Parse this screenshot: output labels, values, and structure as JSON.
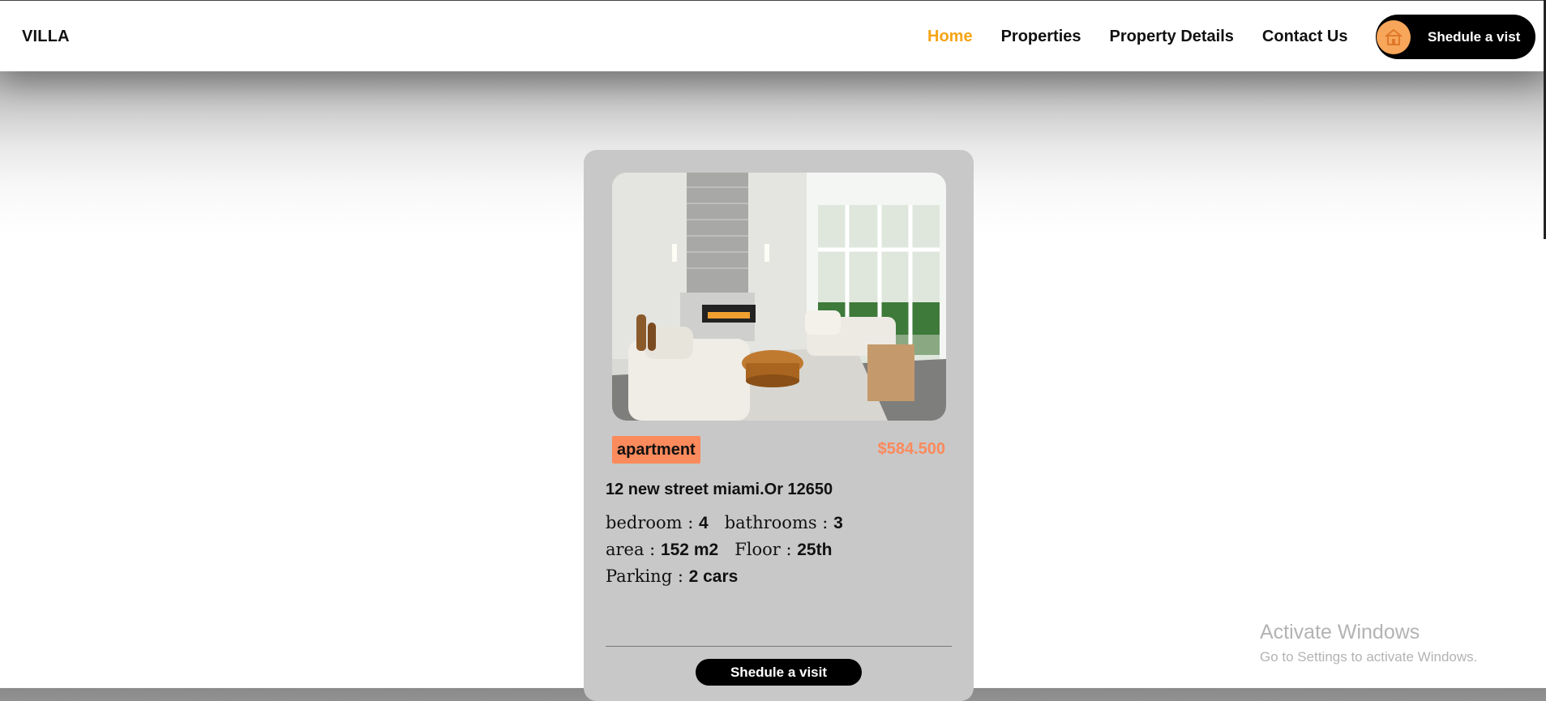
{
  "header": {
    "brand": "VILLA",
    "nav": [
      "Home",
      "Properties",
      "Property Details",
      "Contact Us"
    ],
    "active_nav": "Home",
    "cta_label": "Shedule a vist",
    "cta_icon": "house-icon"
  },
  "listing": {
    "type_tag": "apartment",
    "price": "$584.500",
    "address": "12 new street miami.Or 12650",
    "specs": {
      "bedroom_label": "bedroom :",
      "bedroom_value": "4",
      "bathrooms_label": "bathrooms :",
      "bathrooms_value": "3",
      "area_label": "area :",
      "area_value": "152 m2",
      "floor_label": "Floor :",
      "floor_value": "25th",
      "parking_label": "Parking :",
      "parking_value": "2 cars"
    },
    "button_label": "Shedule a visit"
  },
  "watermark": {
    "title": "Activate Windows",
    "subtitle": "Go to Settings to activate Windows."
  },
  "colors": {
    "accent_orange": "#f6a415",
    "tag_salmon": "#fb8a5c",
    "card_gray": "#c8c8c8"
  }
}
